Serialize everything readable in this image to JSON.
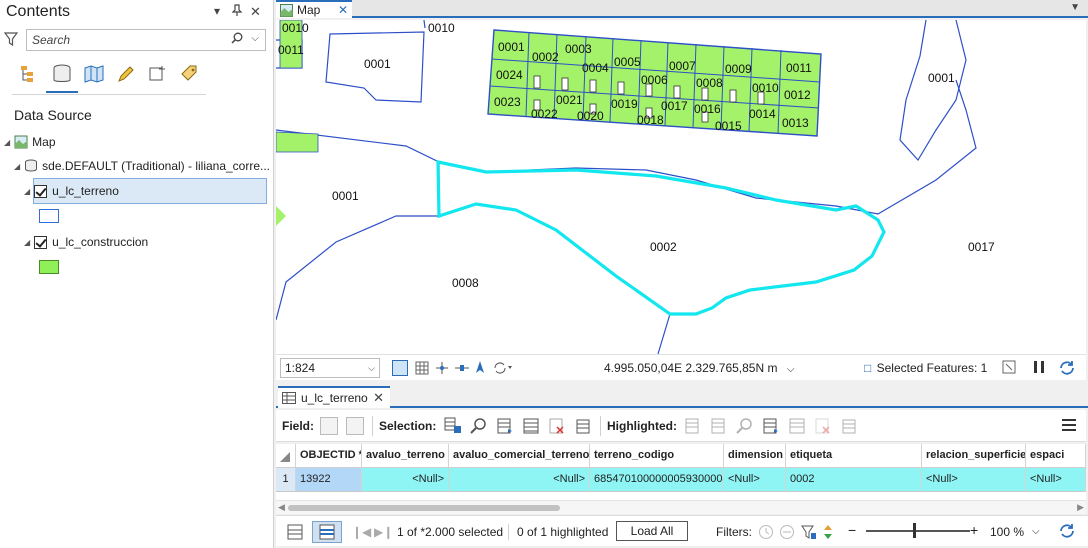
{
  "contents": {
    "title": "Contents",
    "ctrl_menu": "▾",
    "ctrl_pin": "📌",
    "ctrl_close": "✕",
    "search_placeholder": "Search",
    "data_source_title": "Data Source",
    "tree": {
      "map_label": "Map",
      "db_label": "sde.DEFAULT (Traditional) - liliana_corre...",
      "layer1_label": "u_lc_terreno",
      "layer2_label": "u_lc_construccion"
    },
    "symbols": {
      "terreno_stroke": "#2d6fd6",
      "construccion_fill": "#90f058"
    }
  },
  "map": {
    "tab_label": "Map",
    "colors": {
      "parcel_line": "#2d4fc8",
      "building_fill": "#a4f26a",
      "selection": "#12e6ee"
    },
    "labels": {
      "l0010a": "0010",
      "l0010b": "0010",
      "l0011a": "0011",
      "l0001a": "0001",
      "l0001b": "0001",
      "l0001c": "0001",
      "l0002": "0002",
      "l0017": "0017",
      "l0008": "0008",
      "b0001": "0001",
      "b0002": "0002",
      "b0003": "0003",
      "b0004": "0004",
      "b0005": "0005",
      "b0006": "0006",
      "b0007": "0007",
      "b0008": "0008",
      "b0009": "0009",
      "b0010": "0010",
      "b0011": "0011",
      "b0012": "0012",
      "b0013": "0013",
      "b0014": "0014",
      "b0015": "0015",
      "b0016": "0016",
      "b0017": "0017",
      "b0018": "0018",
      "b0019": "0019",
      "b0020": "0020",
      "b0021": "0021",
      "b0022": "0022",
      "b0023": "0023",
      "b0024": "0024"
    },
    "status": {
      "scale": "1:824",
      "coordinates": "4.995.050,04E 2.329.765,85N m",
      "selected_features": "Selected Features: 1"
    }
  },
  "table": {
    "tab_label": "u_lc_terreno",
    "toolbar": {
      "field_label": "Field:",
      "selection_label": "Selection:",
      "highlighted_label": "Highlighted:"
    },
    "columns": [
      "OBJECTID *",
      "avaluo_terreno",
      "avaluo_comercial_terreno",
      "terreno_codigo",
      "dimension",
      "etiqueta",
      "relacion_superficie",
      "espaci"
    ],
    "rows": [
      {
        "num": "1",
        "cells": [
          "13922",
          "<Null>",
          "<Null>",
          "685470100000005930000...",
          "<Null>",
          "0002",
          "<Null>",
          "<Null>"
        ]
      }
    ],
    "status": {
      "selected_text": "1 of *2.000 selected",
      "highlighted_text": "0 of 1 highlighted",
      "load_all": "Load All",
      "filters": "Filters:",
      "zoom_minus": "−",
      "zoom_plus": "+",
      "zoom_level": "100 %"
    }
  }
}
